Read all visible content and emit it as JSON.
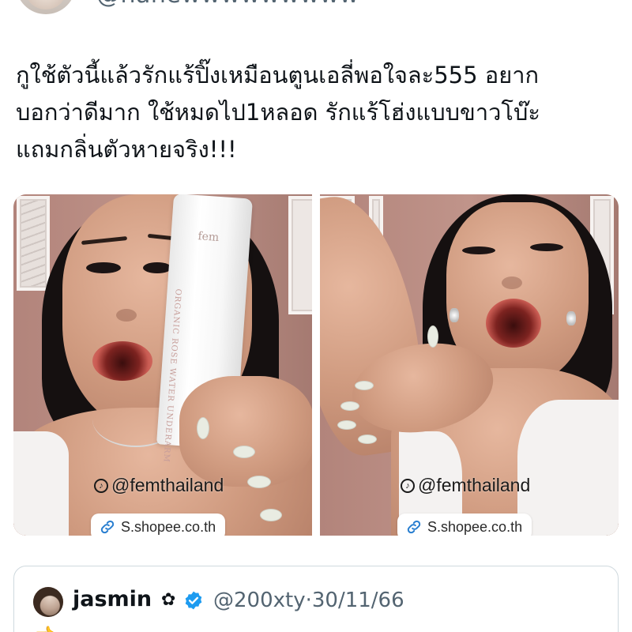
{
  "author": {
    "handle": "@nanewwwwwwwww"
  },
  "tweet": {
    "text": "กูใช้ตัวนี้แล้วรักแร้ปิ๊งเหมือนตูนเอลี่พอใจละ555 อยาก\nบอกว่าดีมาก ใช้หมดไป1หลอด รักแร้โฮ่งแบบขาวโบ๊ะ\nแถมกลิ่นตัวหายจริง!!!"
  },
  "media": [
    {
      "watermark": "@femthailand",
      "link_label": "S.shopee.co.th",
      "product": {
        "logo": "fem",
        "label": "ORGANIC ROSE WATER UNDERARM"
      }
    },
    {
      "watermark": "@femthailand",
      "link_label": "S.shopee.co.th"
    }
  ],
  "quoted": {
    "name": "jasmin",
    "flower": "✿",
    "handle": "@200xty",
    "separator": "·",
    "date": "30/11/66",
    "text_start": "👈 ..."
  },
  "colors": {
    "text": "#0f1419",
    "secondary": "#536471",
    "verified": "#1d9bf0",
    "border": "#cfd9de"
  },
  "icons": [
    "link-icon",
    "verified-badge-icon",
    "tiktok-icon"
  ]
}
